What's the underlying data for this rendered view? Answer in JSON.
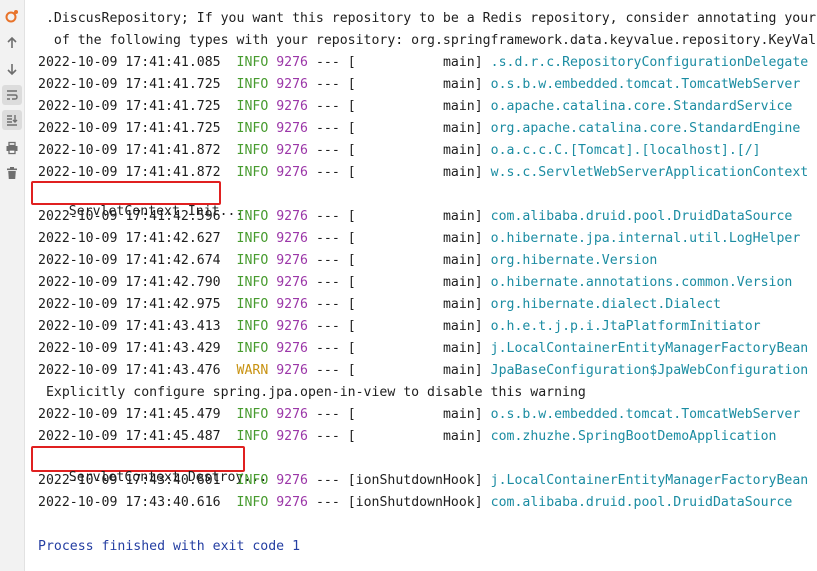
{
  "toolbar": {
    "icons": [
      "rerun-icon",
      "arrow-up-icon",
      "arrow-down-icon",
      "soft-wrap-icon",
      "scroll-to-end-icon",
      "print-icon",
      "trash-icon"
    ]
  },
  "console": {
    "wrapped_lines": [
      " .DiscusRepository; If you want this repository to be a Redis repository, consider annotating your",
      "  of the following types with your repository: org.springframework.data.keyvalue.repository.KeyVal"
    ],
    "log_lines_a": [
      {
        "ts": "2022-10-09 17:41:41.085",
        "level": "INFO",
        "pid": "9276",
        "sep": " --- [",
        "thread": "           main]",
        "logger": ".s.d.r.c.RepositoryConfigurationDelegate"
      },
      {
        "ts": "2022-10-09 17:41:41.725",
        "level": "INFO",
        "pid": "9276",
        "sep": " --- [",
        "thread": "           main]",
        "logger": "o.s.b.w.embedded.tomcat.TomcatWebServer"
      },
      {
        "ts": "2022-10-09 17:41:41.725",
        "level": "INFO",
        "pid": "9276",
        "sep": " --- [",
        "thread": "           main]",
        "logger": "o.apache.catalina.core.StandardService"
      },
      {
        "ts": "2022-10-09 17:41:41.725",
        "level": "INFO",
        "pid": "9276",
        "sep": " --- [",
        "thread": "           main]",
        "logger": "org.apache.catalina.core.StandardEngine"
      },
      {
        "ts": "2022-10-09 17:41:41.872",
        "level": "INFO",
        "pid": "9276",
        "sep": " --- [",
        "thread": "           main]",
        "logger": "o.a.c.c.C.[Tomcat].[localhost].[/]"
      },
      {
        "ts": "2022-10-09 17:41:41.872",
        "level": "INFO",
        "pid": "9276",
        "sep": " --- [",
        "thread": "           main]",
        "logger": "w.s.c.ServletWebServerApplicationContext"
      }
    ],
    "init_message": "ServletContext Init...",
    "log_lines_b": [
      {
        "ts": "2022-10-09 17:41:42.596",
        "level": "INFO",
        "pid": "9276",
        "sep": " --- [",
        "thread": "           main]",
        "logger": "com.alibaba.druid.pool.DruidDataSource"
      },
      {
        "ts": "2022-10-09 17:41:42.627",
        "level": "INFO",
        "pid": "9276",
        "sep": " --- [",
        "thread": "           main]",
        "logger": "o.hibernate.jpa.internal.util.LogHelper"
      },
      {
        "ts": "2022-10-09 17:41:42.674",
        "level": "INFO",
        "pid": "9276",
        "sep": " --- [",
        "thread": "           main]",
        "logger": "org.hibernate.Version"
      },
      {
        "ts": "2022-10-09 17:41:42.790",
        "level": "INFO",
        "pid": "9276",
        "sep": " --- [",
        "thread": "           main]",
        "logger": "o.hibernate.annotations.common.Version"
      },
      {
        "ts": "2022-10-09 17:41:42.975",
        "level": "INFO",
        "pid": "9276",
        "sep": " --- [",
        "thread": "           main]",
        "logger": "org.hibernate.dialect.Dialect"
      },
      {
        "ts": "2022-10-09 17:41:43.413",
        "level": "INFO",
        "pid": "9276",
        "sep": " --- [",
        "thread": "           main]",
        "logger": "o.h.e.t.j.p.i.JtaPlatformInitiator"
      },
      {
        "ts": "2022-10-09 17:41:43.429",
        "level": "INFO",
        "pid": "9276",
        "sep": " --- [",
        "thread": "           main]",
        "logger": "j.LocalContainerEntityManagerFactoryBean"
      },
      {
        "ts": "2022-10-09 17:41:43.476",
        "level": "WARN",
        "pid": "9276",
        "sep": " --- [",
        "thread": "           main]",
        "logger": "JpaBaseConfiguration$JpaWebConfiguration"
      }
    ],
    "warning_text": " Explicitly configure spring.jpa.open-in-view to disable this warning",
    "log_lines_c": [
      {
        "ts": "2022-10-09 17:41:45.479",
        "level": "INFO",
        "pid": "9276",
        "sep": " --- [",
        "thread": "           main]",
        "logger": "o.s.b.w.embedded.tomcat.TomcatWebServer"
      },
      {
        "ts": "2022-10-09 17:41:45.487",
        "level": "INFO",
        "pid": "9276",
        "sep": " --- [",
        "thread": "           main]",
        "logger": "com.zhuzhe.SpringBootDemoApplication"
      }
    ],
    "destroy_message": "ServletContext Destroy...",
    "log_lines_d": [
      {
        "ts": "2022-10-09 17:43:40.601",
        "level": "INFO",
        "pid": "9276",
        "sep": " --- [",
        "thread": "ionShutdownHook]",
        "logger": "j.LocalContainerEntityManagerFactoryBean"
      },
      {
        "ts": "2022-10-09 17:43:40.616",
        "level": "INFO",
        "pid": "9276",
        "sep": " --- [",
        "thread": "ionShutdownHook]",
        "logger": "com.alibaba.druid.pool.DruidDataSource"
      }
    ],
    "exit_message": "Process finished with exit code 1"
  },
  "colors": {
    "info": "#479b2e",
    "warn": "#c89211",
    "pid": "#9b36a8",
    "logger": "#1b8ca2",
    "exit_text": "#243ea2",
    "highlight_border": "#e02020"
  }
}
